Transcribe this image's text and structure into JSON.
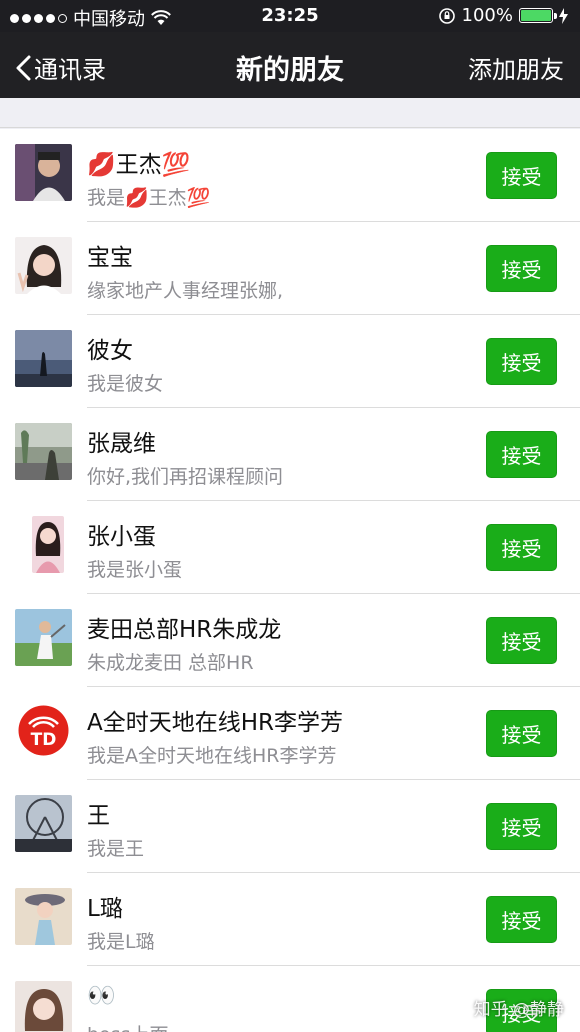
{
  "status_bar": {
    "carrier": "中国移动",
    "time": "23:25",
    "battery": "100%",
    "battery_level": 1.0
  },
  "nav": {
    "back_label": "通讯录",
    "title": "新的朋友",
    "right_label": "添加朋友"
  },
  "requests": [
    {
      "name": "💋王杰💯",
      "message": "我是💋王杰💯",
      "button": "接受"
    },
    {
      "name": "宝宝",
      "message": "缘家地产人事经理张娜,",
      "button": "接受"
    },
    {
      "name": "彼女",
      "message": "我是彼女",
      "button": "接受"
    },
    {
      "name": "张晟维",
      "message": "你好,我们再招课程顾问",
      "button": "接受"
    },
    {
      "name": "张小蛋",
      "message": "我是张小蛋",
      "button": "接受"
    },
    {
      "name": "麦田总部HR朱成龙",
      "message": "朱成龙麦田 总部HR",
      "button": "接受"
    },
    {
      "name": "A全时天地在线HR李学芳",
      "message": "我是A全时天地在线HR李学芳",
      "button": "接受"
    },
    {
      "name": "王",
      "message": "我是王",
      "button": "接受"
    },
    {
      "name": "L璐",
      "message": "我是L璐",
      "button": "接受"
    },
    {
      "name": "👀",
      "message": "boss上面",
      "button": "接受"
    }
  ],
  "watermark": "知乎 @静静"
}
